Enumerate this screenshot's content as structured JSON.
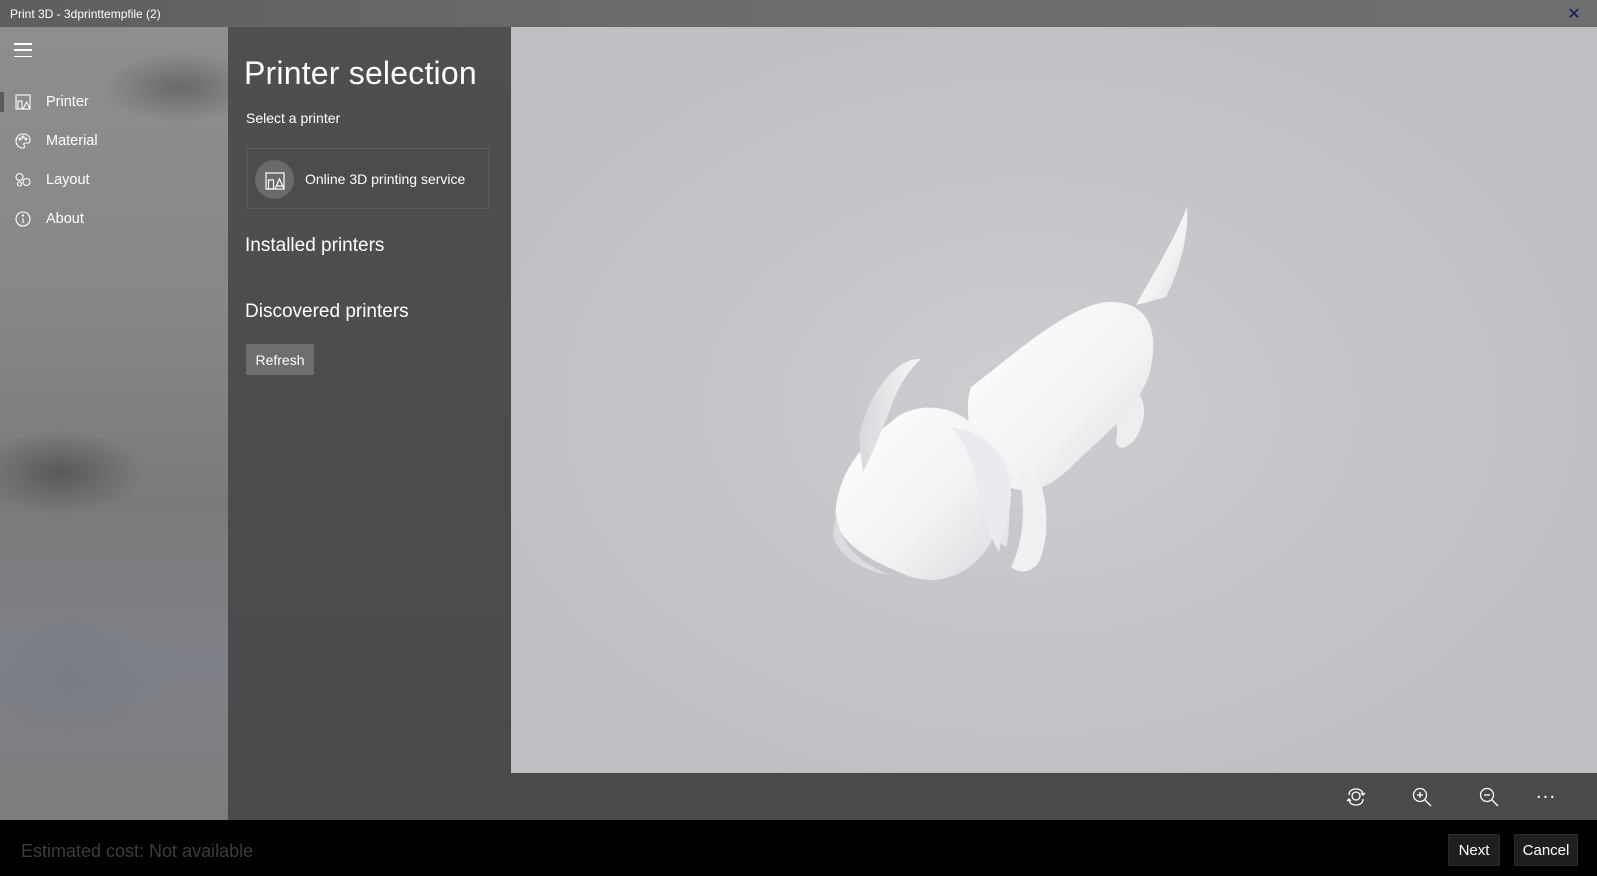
{
  "window": {
    "title": "Print 3D - 3dprinttempfile (2)",
    "close_glyph": "✕"
  },
  "nav": {
    "menu_icon": "hamburger-icon",
    "items": [
      {
        "label": "Printer",
        "icon": "printer-icon",
        "active": true
      },
      {
        "label": "Material",
        "icon": "palette-icon",
        "active": false
      },
      {
        "label": "Layout",
        "icon": "layout-icon",
        "active": false
      },
      {
        "label": "About",
        "icon": "info-icon",
        "active": false
      }
    ]
  },
  "pane": {
    "title": "Printer selection",
    "subtitle": "Select a printer",
    "service_label": "Online 3D printing service",
    "installed_heading": "Installed printers",
    "discovered_heading": "Discovered printers",
    "refresh_label": "Refresh"
  },
  "viewport": {
    "model": "dog-3d-model",
    "background_color": "#c8c6ca",
    "model_color": "#f6f6f7"
  },
  "toolbar": {
    "buttons": [
      "reset-view-icon",
      "zoom-in-icon",
      "zoom-out-icon",
      "more-icon"
    ],
    "more_glyph": "···"
  },
  "footer": {
    "cost_text": "Estimated cost: Not available",
    "next_label": "Next",
    "cancel_label": "Cancel"
  }
}
